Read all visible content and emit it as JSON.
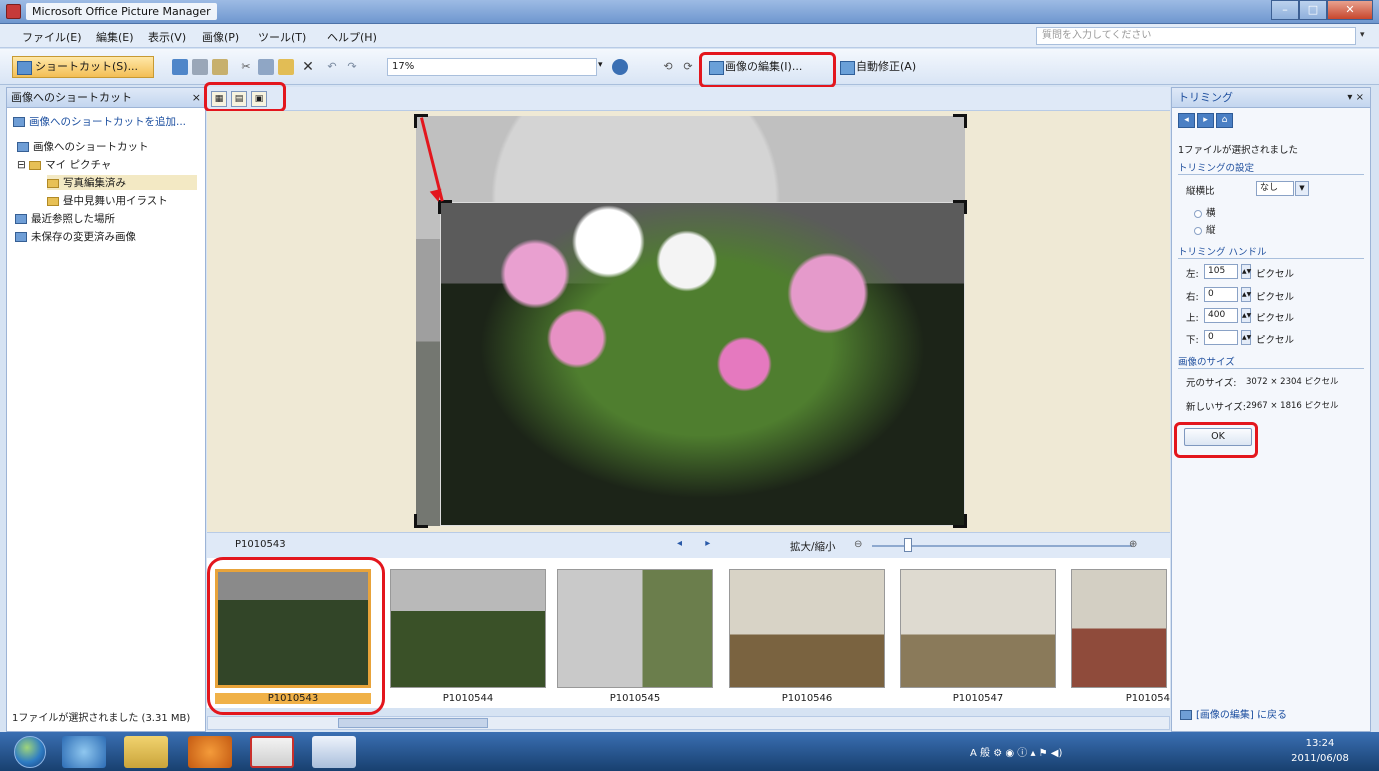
{
  "window": {
    "title": "Microsoft Office Picture Manager",
    "minimize": "–",
    "maximize": "□",
    "close": "✕"
  },
  "menu": {
    "items": [
      "ファイル(E)",
      "編集(E)",
      "表示(V)",
      "画像(P)",
      "ツール(T)",
      "ヘルプ(H)"
    ],
    "help_placeholder": "質問を入力してください"
  },
  "toolbar": {
    "shortcut_label": "ショートカット(S)...",
    "zoom_value": "17%",
    "edit_image_label": "画像の編集(I)...",
    "auto_correct_label": "自動修正(A)"
  },
  "left_pane": {
    "title": "画像へのショートカット",
    "close": "×",
    "add_link": "画像へのショートカットを追加...",
    "tree": [
      {
        "label": "画像へのショートカット"
      },
      {
        "label": "マイ ピクチャ"
      },
      {
        "label": "写真編集済み"
      },
      {
        "label": "昼中見舞い用イラスト"
      },
      {
        "label": "最近参照した場所"
      },
      {
        "label": "未保存の変更済み画像"
      }
    ],
    "status": "1ファイルが選択されました (3.31 MB)"
  },
  "nav": {
    "filename": "P1010543",
    "prev_next": "◂ ▸",
    "zoom_label": "拡大/縮小",
    "zoom_percent": 0.14
  },
  "filmstrip": {
    "items": [
      {
        "label": "P1010543",
        "selected": true
      },
      {
        "label": "P1010544",
        "selected": false
      },
      {
        "label": "P1010545",
        "selected": false
      },
      {
        "label": "P1010546",
        "selected": false
      },
      {
        "label": "P1010547",
        "selected": false
      },
      {
        "label": "P101054",
        "selected": false
      }
    ]
  },
  "right_pane": {
    "title": "トリミング",
    "selection_info": "1ファイルが選択されました",
    "crop_settings": "トリミングの設定",
    "aspect_label": "縦横比",
    "aspect_value": "なし",
    "orientation_landscape": "横",
    "orientation_portrait": "縦",
    "handles_header": "トリミング ハンドル",
    "left_label": "左:",
    "left_value": "105",
    "right_label": "右:",
    "right_value": "0",
    "top_label": "上:",
    "top_value": "400",
    "bottom_label": "下:",
    "bottom_value": "0",
    "unit": "ピクセル",
    "size_header": "画像のサイズ",
    "original_label": "元のサイズ:",
    "original_value": "3072 × 2304 ピクセル",
    "new_label": "新しいサイズ:",
    "new_value": "2967 × 1816 ピクセル",
    "ok": "OK",
    "back_link": "[画像の編集] に戻る"
  },
  "taskbar": {
    "tray_text": "A 般",
    "time": "13:24",
    "date": "2011/06/08"
  },
  "colors": {
    "highlight": "#e3161d",
    "selected_thumb": "#f0b148",
    "accent": "#1f4f9e"
  }
}
